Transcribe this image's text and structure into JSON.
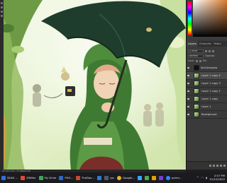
{
  "canvas": {
    "alt": "Digital illustration of a character in a green hooded coat holding a dark green umbrella"
  },
  "panel": {
    "tabs": [
      "Layers",
      "Channels",
      "Paths"
    ],
    "controls": {
      "kind": "Q Kind",
      "blend_mode": "Normal",
      "opacity_label": "Opacity:",
      "lock_label": "Lock:",
      "fill_label": "Fill:"
    },
    "layers": [
      {
        "name": "ilov2shoujaw",
        "thumb": "mask",
        "selected": false
      },
      {
        "name": "Layer 1 copy 4",
        "thumb": "art",
        "selected": true
      },
      {
        "name": "Layer 1 copy 3",
        "thumb": "art",
        "selected": false
      },
      {
        "name": "Layer 1 copy 2",
        "thumb": "art",
        "selected": false
      },
      {
        "name": "Layer 1 copy",
        "thumb": "art",
        "selected": false
      },
      {
        "name": "Layer 1",
        "thumb": "art",
        "selected": false
      },
      {
        "name": "Background",
        "thumb": "art",
        "selected": false
      }
    ]
  },
  "status_bar": {
    "text": "33.33%   Doc: 37.9M/83.0M"
  },
  "taskbar": {
    "items": [
      {
        "label": "SEAD ...",
        "color": "#2f6fe0"
      },
      {
        "label": "ZWiller",
        "color": "#e04a2f"
      },
      {
        "label": "My Drive",
        "color": "#3aa757"
      },
      {
        "label": "PHO...",
        "color": "#2e66c9"
      },
      {
        "label": "TheDas...",
        "color": "#c94a2e"
      },
      {
        "label": "",
        "color": "#2b7cd3"
      },
      {
        "label": "rpc",
        "color": "#555b66"
      },
      {
        "label": "Google...",
        "color": "#e8b52b"
      },
      {
        "label": "",
        "color": "#31a8ff"
      },
      {
        "label": "",
        "color": "#4caf50"
      },
      {
        "label": "",
        "color": "#e9a100"
      },
      {
        "label": "",
        "color": "#7a3bd6"
      },
      {
        "label": "pairm...",
        "color": "#2d8cff"
      }
    ],
    "time": "2:57 PM",
    "date": "12/12/2022"
  }
}
